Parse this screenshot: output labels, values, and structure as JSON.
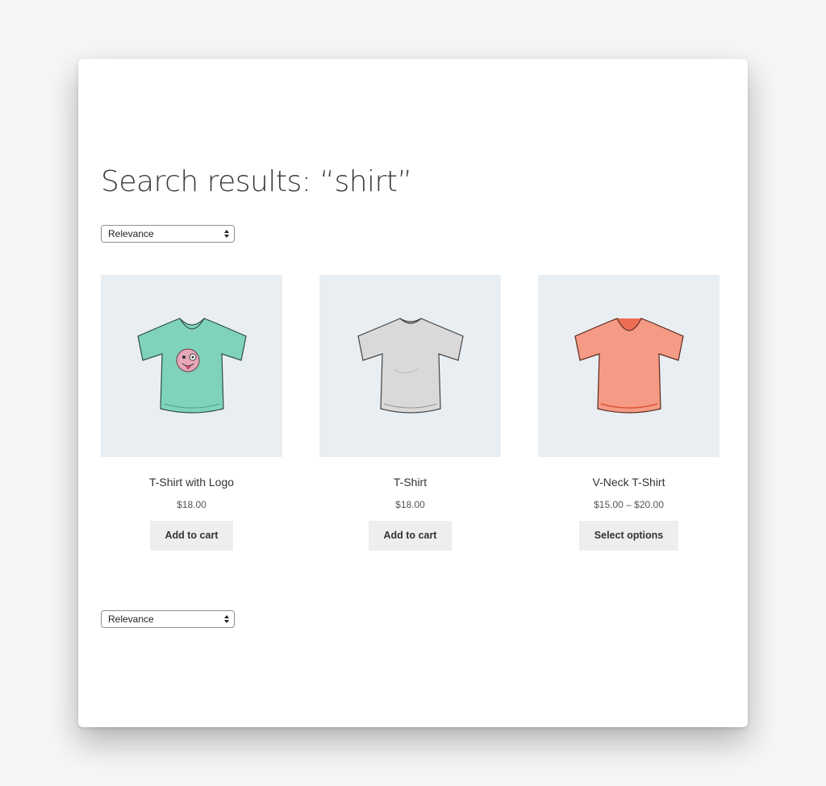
{
  "page": {
    "title": "Search results: “shirt”"
  },
  "ordering": {
    "top": {
      "selected": "Relevance"
    },
    "bottom": {
      "selected": "Relevance"
    }
  },
  "products": [
    {
      "name": "T-Shirt with Logo",
      "price": "$18.00",
      "button": "Add to cart",
      "shirt_color": "#7fd3bb",
      "image": "tshirt-with-logo-image"
    },
    {
      "name": "T-Shirt",
      "price": "$18.00",
      "button": "Add to cart",
      "shirt_color": "#d9d9d9",
      "image": "tshirt-image"
    },
    {
      "name": "V-Neck T-Shirt",
      "price": "$15.00 – $20.00",
      "button": "Select options",
      "shirt_color": "#f59a84",
      "image": "vneck-tshirt-image"
    }
  ]
}
